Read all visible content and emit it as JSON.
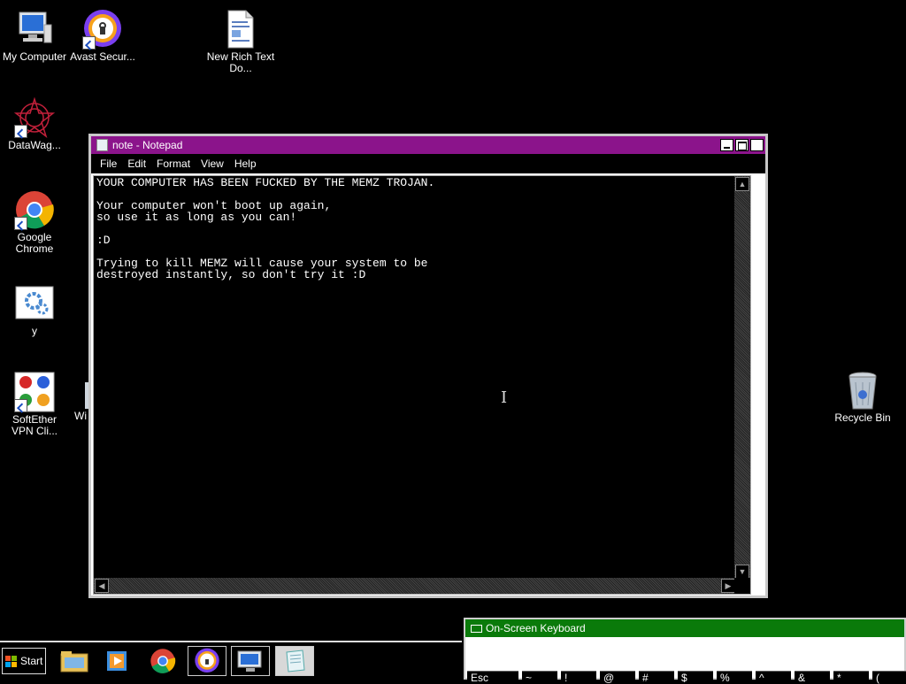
{
  "desktop": {
    "icons": [
      {
        "label": "My Computer"
      },
      {
        "label": "Avast Secur..."
      },
      {
        "label": "New Rich Text Do..."
      },
      {
        "label": "DataWag..."
      },
      {
        "label": "Google Chrome"
      },
      {
        "label": "y"
      },
      {
        "label": "SoftEther VPN Cli..."
      },
      {
        "label": "Wi"
      },
      {
        "label": "Recycle Bin"
      }
    ]
  },
  "notepad": {
    "title": "note - Notepad",
    "menu": [
      "File",
      "Edit",
      "Format",
      "View",
      "Help"
    ],
    "content": "YOUR COMPUTER HAS BEEN FUCKED BY THE MEMZ TROJAN.\n\nYour computer won't boot up again,\nso use it as long as you can!\n\n:D\n\nTrying to kill MEMZ will cause your system to be\ndestroyed instantly, so don't try it :D",
    "colors": {
      "titlebar": "#8b148b",
      "editor_bg": "#000000",
      "text": "#ffffff"
    }
  },
  "taskbar": {
    "start_label": "Start",
    "items": [
      "file-explorer-icon",
      "media-player-icon",
      "chrome-icon",
      "avast-icon",
      "remote-desktop-icon",
      "notepad-icon"
    ]
  },
  "osk": {
    "title": "On-Screen Keyboard",
    "keys": [
      "Esc",
      "~",
      "!",
      "@",
      "#",
      "$",
      "%",
      "^",
      "&",
      "*",
      "("
    ],
    "colors": {
      "titlebar": "#0a7a0a"
    }
  }
}
